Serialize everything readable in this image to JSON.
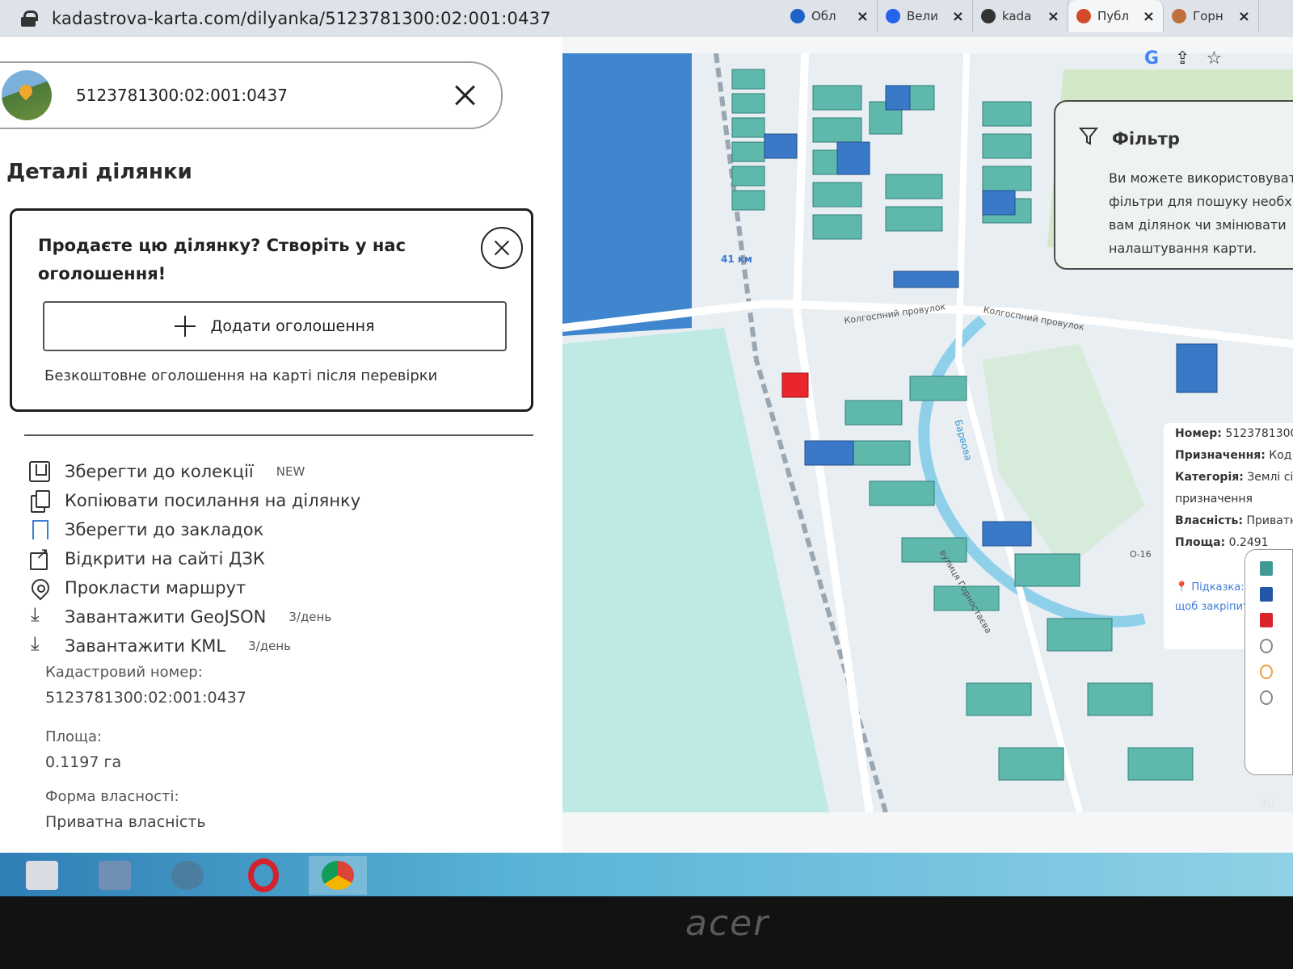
{
  "browser": {
    "url": "kadastrova-karta.com/dilyanka/5123781300:02:001:0437",
    "tabs": [
      {
        "label": "Обл",
        "color": "#1f62c8"
      },
      {
        "label": "Вели",
        "color": "#2563eb"
      },
      {
        "label": "kada",
        "color": "#333333"
      },
      {
        "label": "Публ",
        "color": "#d14a2a",
        "active": true
      },
      {
        "label": "Горн",
        "color": "#c0703a"
      }
    ]
  },
  "search": {
    "value": "5123781300:02:001:0437"
  },
  "panel": {
    "title": "Деталі ділянки",
    "promo": {
      "title": "Продаєте цю ділянку? Створіть у нас оголошення!",
      "button": "Додати оголошення",
      "note": "Безкоштовне оголошення на карті після перевірки"
    },
    "actions": [
      {
        "icon": "bookmark-save-icon",
        "label": "Зберегти до колекції",
        "badge": "NEW"
      },
      {
        "icon": "copy-icon",
        "label": "Копіювати посилання на ділянку",
        "badge": ""
      },
      {
        "icon": "bookmark-icon",
        "label": "Зберегти до закладок",
        "badge": ""
      },
      {
        "icon": "external-link-icon",
        "label": "Відкрити на сайті ДЗК",
        "badge": ""
      },
      {
        "icon": "route-pin-icon",
        "label": "Прокласти маршрут",
        "badge": ""
      },
      {
        "icon": "download-icon",
        "label": "Завантажити GeoJSON",
        "badge": "3/день"
      },
      {
        "icon": "download-icon",
        "label": "Завантажити KML",
        "badge": "3/день"
      }
    ],
    "fields": [
      {
        "label": "Кадастровий номер:",
        "value": "5123781300:02:001:0437"
      },
      {
        "label": "Площа:",
        "value": "0.1197 га"
      },
      {
        "label": "Форма власності:",
        "value": "Приватна власність"
      }
    ]
  },
  "map": {
    "labels": {
      "km": "41 км",
      "street1": "Колгоспний провулок",
      "street2": "Колгоспний провулок",
      "river": "Барвова",
      "street3": "вулиця Горностаєва",
      "road": "О-16"
    },
    "filter": {
      "title": "Фільтр",
      "lines": [
        "Ви можете використовувати",
        "фільтри для пошуку необхідних",
        "вам ділянок чи змінювати",
        "налаштування карти."
      ]
    },
    "info": {
      "lines": [
        {
          "k": "Номер:",
          "v": "5123781300"
        },
        {
          "k": "Призначення:",
          "v": "Код н"
        },
        {
          "k": "Категорія:",
          "v": "Землі сіль"
        },
        {
          "k": "",
          "v": "призначення"
        },
        {
          "k": "Власність:",
          "v": "Приватна"
        },
        {
          "k": "Площа:",
          "v": "0.2491"
        }
      ],
      "hint": "Підказка:",
      "hint2": "щоб закріпити"
    },
    "colors": {
      "parcel": "#5fb8ac",
      "parcel_dark": "#3f9a95",
      "blue": "#3a78c8",
      "selected": "#e8262c",
      "field": "#b8e4e0",
      "water": "#4aa3d6"
    }
  },
  "taskbar": {
    "lang": "RU"
  },
  "brand": "acer"
}
